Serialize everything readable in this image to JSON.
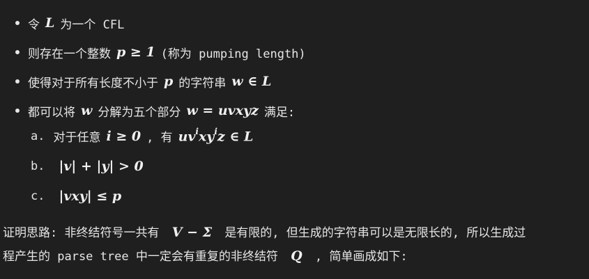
{
  "bullets": [
    {
      "pre": "令",
      "math": "L",
      "post": "为一个 CFL"
    },
    {
      "pre": "则存在一个整数",
      "math": "p ≥ 1",
      "post": "(称为 pumping length)"
    },
    {
      "pre": "使得对于所有长度不小于",
      "math": "p",
      "mid": "的字符串",
      "math2": "w ∈ L",
      "post": ""
    },
    {
      "pre": "都可以将",
      "math": "w",
      "mid": "分解为五个部分",
      "math2": "w = uvxyz",
      "post": "满足:"
    }
  ],
  "conditions": [
    {
      "marker": "a.",
      "pre": "对于任意",
      "math": "i ≥ 0",
      "mid": ", 有",
      "math2_base": "uv",
      "math2_sup1": "i",
      "math2_mid": "xy",
      "math2_sup2": "i",
      "math2_end": "z ∈ L"
    },
    {
      "marker": "b.",
      "math": "|v| + |y| > 0"
    },
    {
      "marker": "c.",
      "math": "|vxy| ≤ p"
    }
  ],
  "proof": {
    "line1_pre": "证明思路: 非终结符号一共有",
    "line1_math": "V − Σ",
    "line1_post": "是有限的, 但生成的字符串可以是无限长的, 所以生成过",
    "line2_pre": "程产生的 parse tree 中一定会有重复的非终结符",
    "line2_math": "Q",
    "line2_post": ", 简单画成如下:"
  }
}
